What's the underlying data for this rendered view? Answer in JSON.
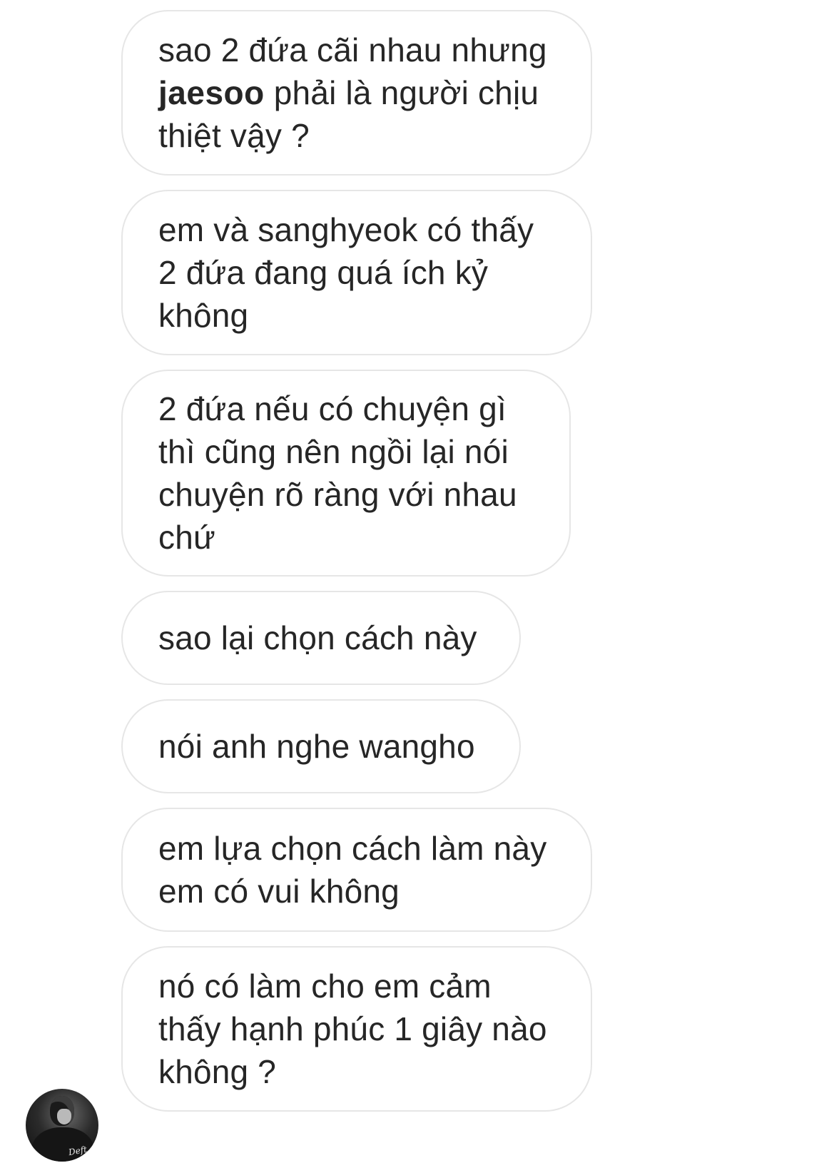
{
  "thread": {
    "messages": [
      {
        "text_before": "sao 2 đứa cãi nhau nhưng\n",
        "mention": "jaesoo",
        "text_after": "  phải là người chịu\nthiệt vậy ?"
      },
      {
        "text": "em và sanghyeok có thấy\n2 đứa đang quá ích kỷ\nkhông"
      },
      {
        "text": "2 đứa nếu có chuyện gì\nthì cũng nên ngồi lại nói\nchuyện rõ ràng với nhau\nchứ"
      },
      {
        "text": "sao lại chọn cách này"
      },
      {
        "text": "nói anh nghe wangho"
      },
      {
        "text": "em lựa chọn cách làm này\nem có vui không"
      },
      {
        "text": "nó có làm cho em cảm\nthấy hạnh phúc 1 giây nào\nkhông ?"
      }
    ],
    "sender_avatar": {
      "icon": "profile-photo",
      "signature": "Deft"
    }
  }
}
